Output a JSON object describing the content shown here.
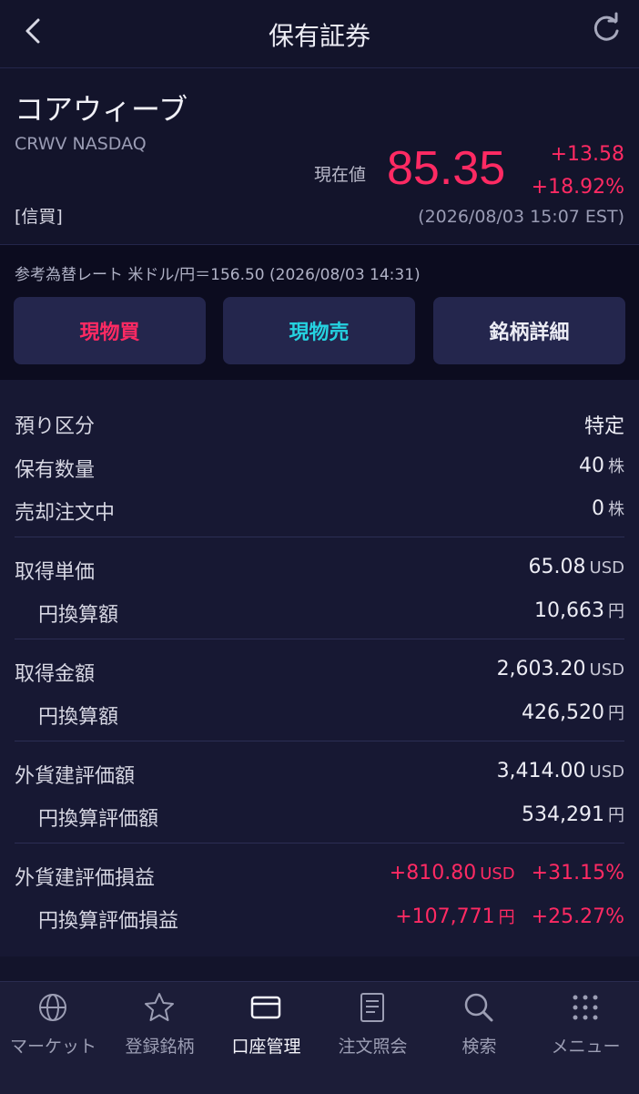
{
  "header": {
    "title": "保有証券"
  },
  "stock": {
    "name": "コアウィーブ",
    "code": "CRWV NASDAQ",
    "credit_label": "[信買]",
    "price_label": "現在値",
    "price": "85.35",
    "change": "+13.58",
    "change_pct": "+18.92%",
    "timestamp": "(2026/08/03 15:07 EST)"
  },
  "exchange_rate": "参考為替レート 米ドル/円＝156.50 (2026/08/03 14:31)",
  "buttons": {
    "buy": "現物買",
    "sell": "現物売",
    "detail": "銘柄詳細"
  },
  "details": {
    "deposit_type": {
      "label": "預り区分",
      "value": "特定"
    },
    "holding_qty": {
      "label": "保有数量",
      "value": "40",
      "unit": "株"
    },
    "selling_order": {
      "label": "売却注文中",
      "value": "0",
      "unit": "株"
    },
    "acq_unit_price": {
      "label": "取得単価",
      "value": "65.08",
      "unit": "USD"
    },
    "acq_unit_price_yen": {
      "label": "円換算額",
      "value": "10,663",
      "unit": "円"
    },
    "acq_amount": {
      "label": "取得金額",
      "value": "2,603.20",
      "unit": "USD"
    },
    "acq_amount_yen": {
      "label": "円換算額",
      "value": "426,520",
      "unit": "円"
    },
    "fx_valuation": {
      "label": "外貨建評価額",
      "value": "3,414.00",
      "unit": "USD"
    },
    "yen_valuation": {
      "label": "円換算評価額",
      "value": "534,291",
      "unit": "円"
    },
    "fx_pnl": {
      "label": "外貨建評価損益",
      "value": "+810.80",
      "unit": "USD",
      "pct": "+31.15%"
    },
    "yen_pnl": {
      "label": "円換算評価損益",
      "value": "+107,771",
      "unit": "円",
      "pct": "+25.27%"
    }
  },
  "tabs": [
    {
      "label": "マーケット",
      "icon": "globe-icon"
    },
    {
      "label": "登録銘柄",
      "icon": "star-icon"
    },
    {
      "label": "口座管理",
      "icon": "card-icon",
      "active": true
    },
    {
      "label": "注文照会",
      "icon": "document-icon"
    },
    {
      "label": "検索",
      "icon": "search-icon"
    },
    {
      "label": "メニュー",
      "icon": "grid-icon"
    }
  ],
  "colors": {
    "up": "#ff2a63",
    "sell": "#25d2e0",
    "background": "#13142b"
  }
}
